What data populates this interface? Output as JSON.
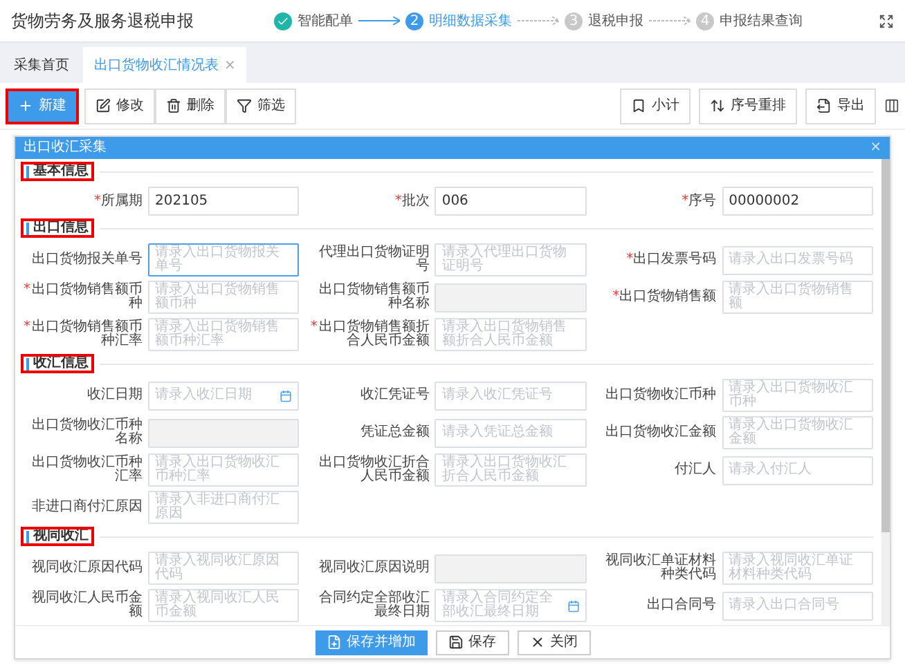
{
  "app_title": "货物劳务及服务退税申报",
  "steps": [
    {
      "label": "智能配单",
      "done": true,
      "current": false
    },
    {
      "label": "明细数据采集",
      "done": false,
      "current": true
    },
    {
      "label": "退税申报",
      "done": false,
      "current": false
    },
    {
      "label": "申报结果查询",
      "done": false,
      "current": false
    }
  ],
  "required_mark": "*",
  "step_numbers": [
    "2",
    "3",
    "4"
  ],
  "tabs": [
    {
      "label": "采集首页",
      "selected": false,
      "closable": false
    },
    {
      "label": "出口货物收汇情况表",
      "selected": true,
      "closable": true
    }
  ],
  "tab_close": "×",
  "toolbar_left": [
    {
      "label": "新建",
      "kind": "primary",
      "highlighted": true
    },
    {
      "label": "修改",
      "kind": "default",
      "highlighted": false
    },
    {
      "label": "删除",
      "kind": "default",
      "highlighted": false
    },
    {
      "label": "筛选",
      "kind": "default",
      "highlighted": false
    }
  ],
  "toolbar_right": [
    {
      "label": "小计"
    },
    {
      "label": "序号重排"
    },
    {
      "label": "导出"
    }
  ],
  "dialog": {
    "title": "出口收汇采集",
    "close": "×",
    "sections": [
      {
        "title": "基本信息",
        "highlighted": true,
        "rows": [
          [
            {
              "label": "所属期",
              "required": true,
              "kind": "text",
              "value": "202105",
              "focused": false
            },
            {
              "label": "批次",
              "required": true,
              "kind": "text",
              "value": "006",
              "focused": false
            },
            {
              "label": "序号",
              "required": true,
              "kind": "text",
              "value": "00000002",
              "focused": false
            }
          ]
        ]
      },
      {
        "title": "出口信息",
        "highlighted": true,
        "rows": [
          [
            {
              "label": "出口货物报关单号",
              "required": false,
              "kind": "text",
              "placeholder": "请录入出口货物报关单号",
              "focused": true
            },
            {
              "label": "代理出口货物证明号",
              "required": false,
              "kind": "text",
              "placeholder": "请录入代理出口货物证明号",
              "focused": false
            },
            {
              "label": "出口发票号码",
              "required": true,
              "kind": "text",
              "placeholder": "请录入出口发票号码",
              "focused": false
            }
          ],
          [
            {
              "label": "出口货物销售额币种",
              "required": true,
              "kind": "text",
              "placeholder": "请录入出口货物销售额币种",
              "focused": false
            },
            {
              "label": "出口货物销售额币种名称",
              "required": false,
              "kind": "disabled",
              "focused": false
            },
            {
              "label": "出口货物销售额",
              "required": true,
              "kind": "text",
              "placeholder": "请录入出口货物销售额",
              "focused": false
            }
          ],
          [
            {
              "label": "出口货物销售额币种汇率",
              "required": true,
              "kind": "text",
              "placeholder": "请录入出口货物销售额币种汇率",
              "focused": false
            },
            {
              "label": "出口货物销售额折合人民币金额",
              "required": true,
              "kind": "text",
              "placeholder": "请录入出口货物销售额折合人民币金额",
              "focused": false
            }
          ]
        ]
      },
      {
        "title": "收汇信息",
        "highlighted": true,
        "rows": [
          [
            {
              "label": "收汇日期",
              "required": false,
              "kind": "date",
              "placeholder": "请录入收汇日期",
              "focused": false
            },
            {
              "label": "收汇凭证号",
              "required": false,
              "kind": "text",
              "placeholder": "请录入收汇凭证号",
              "focused": false
            },
            {
              "label": "出口货物收汇币种",
              "required": false,
              "kind": "text",
              "placeholder": "请录入出口货物收汇币种",
              "focused": false
            }
          ],
          [
            {
              "label": "出口货物收汇币种名称",
              "required": false,
              "kind": "disabled",
              "focused": false
            },
            {
              "label": "凭证总金额",
              "required": false,
              "kind": "text",
              "placeholder": "请录入凭证总金额",
              "focused": false
            },
            {
              "label": "出口货物收汇金额",
              "required": false,
              "kind": "text",
              "placeholder": "请录入出口货物收汇金额",
              "focused": false
            }
          ],
          [
            {
              "label": "出口货物收汇币种汇率",
              "required": false,
              "kind": "text",
              "placeholder": "请录入出口货物收汇币种汇率",
              "focused": false
            },
            {
              "label": "出口货物收汇折合人民币金额",
              "required": false,
              "kind": "text",
              "placeholder": "请录入出口货物收汇折合人民币金额",
              "focused": false
            },
            {
              "label": "付汇人",
              "required": false,
              "kind": "text",
              "placeholder": "请录入付汇人",
              "focused": false
            }
          ],
          [
            {
              "label": "非进口商付汇原因",
              "required": false,
              "kind": "text",
              "placeholder": "请录入非进口商付汇原因",
              "focused": false
            }
          ]
        ]
      },
      {
        "title": "视同收汇",
        "highlighted": true,
        "rows": [
          [
            {
              "label": "视同收汇原因代码",
              "required": false,
              "kind": "text",
              "placeholder": "请录入视同收汇原因代码",
              "focused": false
            },
            {
              "label": "视同收汇原因说明",
              "required": false,
              "kind": "disabled",
              "focused": false
            },
            {
              "label": "视同收汇单证材料种类代码",
              "required": false,
              "kind": "text",
              "placeholder": "请录入视同收汇单证材料种类代码",
              "focused": false
            }
          ],
          [
            {
              "label": "视同收汇人民币金额",
              "required": false,
              "kind": "text",
              "placeholder": "请录入视同收汇人民币金额",
              "focused": false
            },
            {
              "label": "合同约定全部收汇最终日期",
              "required": false,
              "kind": "date",
              "placeholder": "请录入合同约定全部收汇最终日期",
              "focused": false
            },
            {
              "label": "出口合同号",
              "required": false,
              "kind": "text",
              "placeholder": "请录入出口合同号",
              "focused": false
            }
          ]
        ]
      }
    ],
    "footer": [
      {
        "label": "保存并增加",
        "kind": "primary"
      },
      {
        "label": "保存",
        "kind": "default"
      },
      {
        "label": "关闭",
        "kind": "default"
      }
    ]
  }
}
